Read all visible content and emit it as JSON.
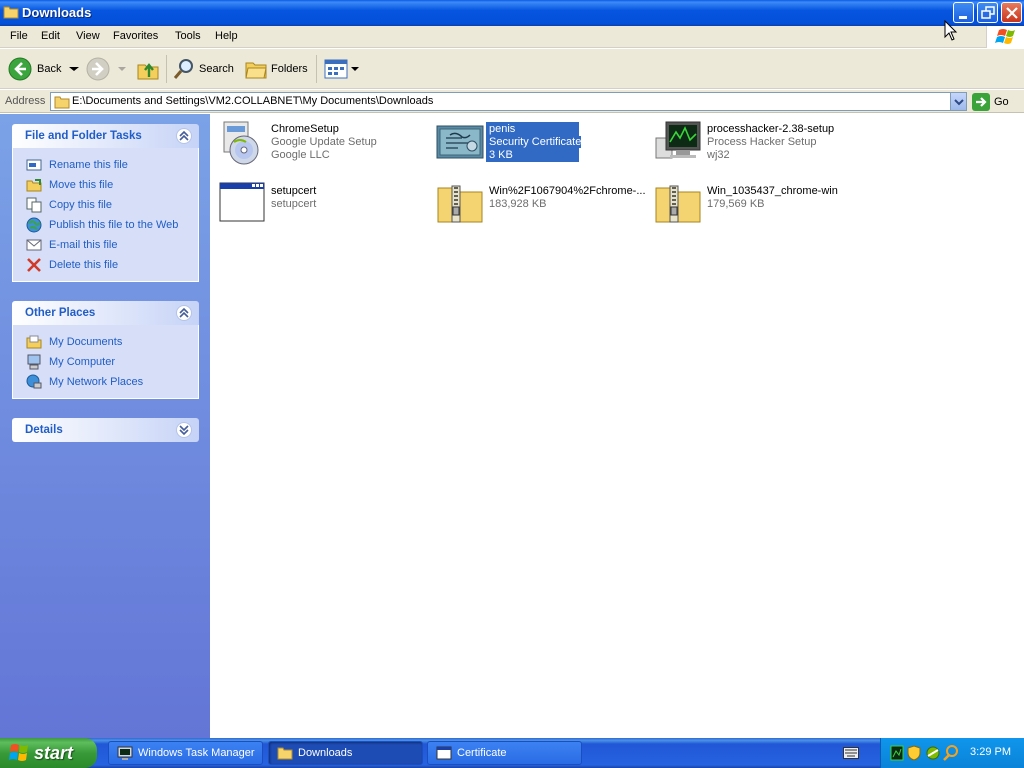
{
  "window": {
    "title": "Downloads"
  },
  "menu": [
    "File",
    "Edit",
    "View",
    "Favorites",
    "Tools",
    "Help"
  ],
  "toolbar": {
    "back": "Back",
    "search": "Search",
    "folders": "Folders"
  },
  "address": {
    "label": "Address",
    "path": "E:\\Documents and Settings\\VM2.COLLABNET\\My Documents\\Downloads",
    "go": "Go"
  },
  "tasks_panel": {
    "title": "File and Folder Tasks",
    "items": [
      "Rename this file",
      "Move this file",
      "Copy this file",
      "Publish this file to the Web",
      "E-mail this file",
      "Delete this file"
    ]
  },
  "places_panel": {
    "title": "Other Places",
    "items": [
      "My Documents",
      "My Computer",
      "My Network Places"
    ]
  },
  "details_panel": {
    "title": "Details"
  },
  "files": [
    {
      "name": "ChromeSetup",
      "line2": "Google Update Setup",
      "line3": "Google LLC",
      "icon": "installer-cd-icon"
    },
    {
      "name": "penis",
      "line2": "Security Certificate",
      "line3": "3 KB",
      "icon": "certificate-icon",
      "selected": true
    },
    {
      "name": "processhacker-2.38-setup",
      "line2": "Process Hacker Setup",
      "line3": "wj32",
      "icon": "installer-monitor-icon"
    },
    {
      "name": "setupcert",
      "line2": "setupcert",
      "line3": "",
      "icon": "application-window-icon"
    },
    {
      "name": "Win%2F1067904%2Fchrome-...",
      "line2": "183,928 KB",
      "line3": "",
      "icon": "zip-folder-icon"
    },
    {
      "name": "Win_1035437_chrome-win",
      "line2": "179,569 KB",
      "line3": "",
      "icon": "zip-folder-icon"
    }
  ],
  "taskbar": {
    "start": "start",
    "buttons": [
      {
        "label": "Windows Task Manager",
        "active": false
      },
      {
        "label": "Downloads",
        "active": true
      },
      {
        "label": "Certificate",
        "active": false
      }
    ],
    "clock": "3:29 PM"
  },
  "colors": {
    "title_blue": "#0655e0",
    "link_blue": "#215dc6",
    "selection": "#316ac5",
    "start_green": "#389a38"
  }
}
